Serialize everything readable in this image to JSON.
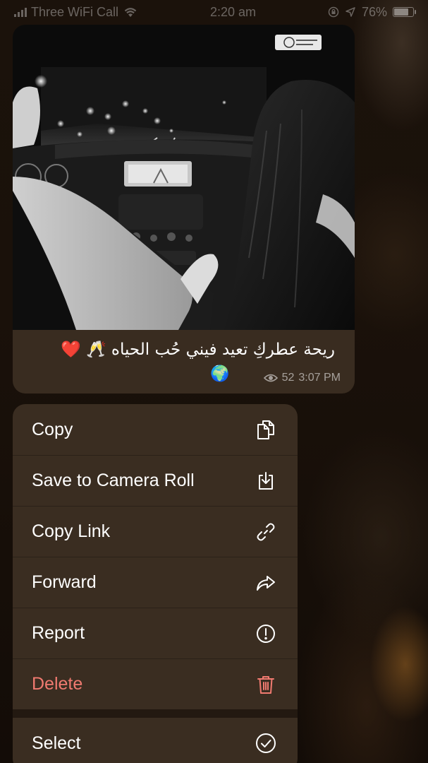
{
  "status_bar": {
    "carrier": "Three WiFi Call",
    "time": "2:20 am",
    "battery": "76%",
    "battery_level": 0.76
  },
  "message": {
    "caption": "ريحة عطركِ تعيد فيني حُب الحياه 🥂 ❤️",
    "caption_emoji_line": "🌍",
    "views": "52",
    "time": "3:07 PM",
    "photo_icon": "car-night-photo"
  },
  "menu": {
    "items": [
      {
        "label": "Copy",
        "icon": "copy-icon"
      },
      {
        "label": "Save to Camera Roll",
        "icon": "save-icon"
      },
      {
        "label": "Copy Link",
        "icon": "link-icon"
      },
      {
        "label": "Forward",
        "icon": "forward-icon"
      },
      {
        "label": "Report",
        "icon": "report-icon"
      },
      {
        "label": "Delete",
        "icon": "trash-icon",
        "color": "#f07a70"
      },
      {
        "label": "Select",
        "icon": "select-check-icon"
      }
    ]
  }
}
